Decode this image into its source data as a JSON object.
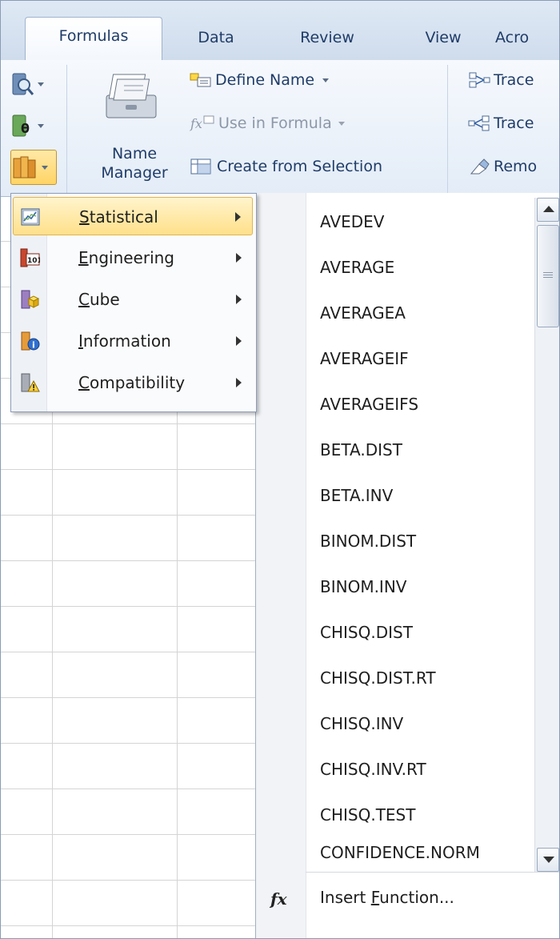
{
  "tabs": [
    {
      "label": "Formulas",
      "active": true
    },
    {
      "label": "Data",
      "active": false
    },
    {
      "label": "Review",
      "active": false
    },
    {
      "label": "View",
      "active": false
    },
    {
      "label": "Acro",
      "active": false
    }
  ],
  "ribbon": {
    "name_manager": {
      "line1": "Name",
      "line2": "Manager"
    },
    "define_name": "Define Name",
    "use_in_formula": "Use in Formula",
    "create_from_selection": "Create from Selection",
    "trace_precedents": "Trace",
    "trace_dependents": "Trace",
    "remove_arrows": "Remo"
  },
  "category_menu": {
    "items": [
      {
        "label": "Statistical",
        "accel": "S",
        "rest": "tatistical",
        "selected": true,
        "icon": "statistical-chart-book-icon"
      },
      {
        "label": "Engineering",
        "accel": "E",
        "rest": "ngineering",
        "selected": false,
        "icon": "engineering-101-book-icon"
      },
      {
        "label": "Cube",
        "accel": "C",
        "rest": "ube",
        "selected": false,
        "icon": "cube-book-icon"
      },
      {
        "label": "Information",
        "accel": "I",
        "rest": "nformation",
        "selected": false,
        "icon": "information-book-icon"
      },
      {
        "label": "Compatibility",
        "accel": "C",
        "rest": "ompatibility",
        "selected": false,
        "icon": "compatibility-warning-book-icon"
      }
    ]
  },
  "function_menu": {
    "items": [
      "AVEDEV",
      "AVERAGE",
      "AVERAGEA",
      "AVERAGEIF",
      "AVERAGEIFS",
      "BETA.DIST",
      "BETA.INV",
      "BINOM.DIST",
      "BINOM.INV",
      "CHISQ.DIST",
      "CHISQ.DIST.RT",
      "CHISQ.INV",
      "CHISQ.INV.RT",
      "CHISQ.TEST",
      "CONFIDENCE.NORM"
    ],
    "insert_function": {
      "pre": "Insert ",
      "accel": "F",
      "post": "unction..."
    },
    "fx_glyph": "fx"
  },
  "colors": {
    "accent_highlight": "#ffe08a",
    "ribbon_bg": "#e3ecf7",
    "text": "#1f3c68"
  }
}
